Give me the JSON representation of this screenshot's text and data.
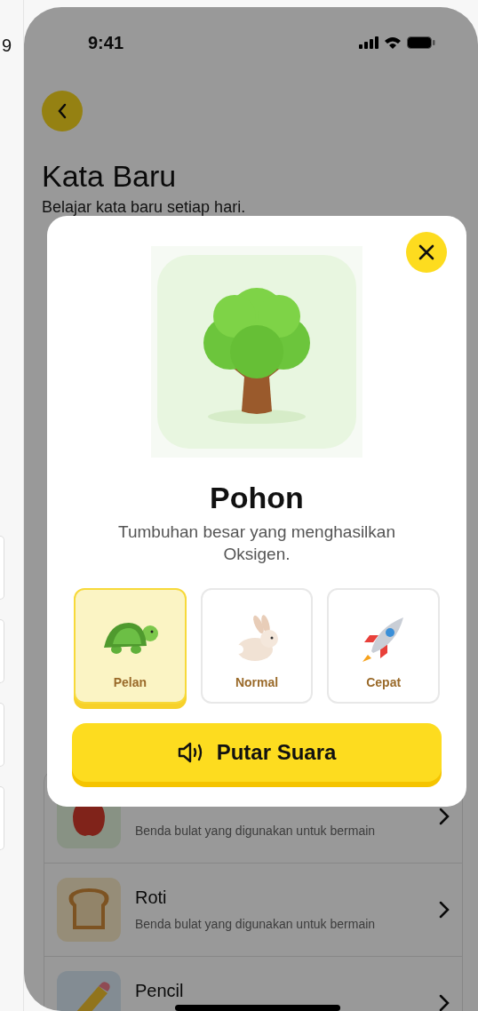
{
  "side_screen": {
    "time_fragment": "9"
  },
  "status_bar": {
    "time": "9:41"
  },
  "header": {
    "title": "Kata Baru",
    "subtitle": "Belajar kata baru setiap hari."
  },
  "words": [
    {
      "kind": "apple",
      "description": "Benda bulat yang digunakan untuk bermain"
    },
    {
      "kind": "bread",
      "name": "Roti",
      "description": "Benda bulat yang digunakan untuk bermain"
    },
    {
      "kind": "pencil",
      "name": "Pencil"
    }
  ],
  "modal": {
    "kind": "tree",
    "word": "Pohon",
    "definition": "Tumbuhan besar yang menghasilkan Oksigen.",
    "speeds": [
      {
        "kind": "turtle",
        "label": "Pelan",
        "selected": true
      },
      {
        "kind": "rabbit",
        "label": "Normal",
        "selected": false
      },
      {
        "kind": "rocket",
        "label": "Cepat",
        "selected": false
      }
    ],
    "play_button": "Putar Suara"
  }
}
